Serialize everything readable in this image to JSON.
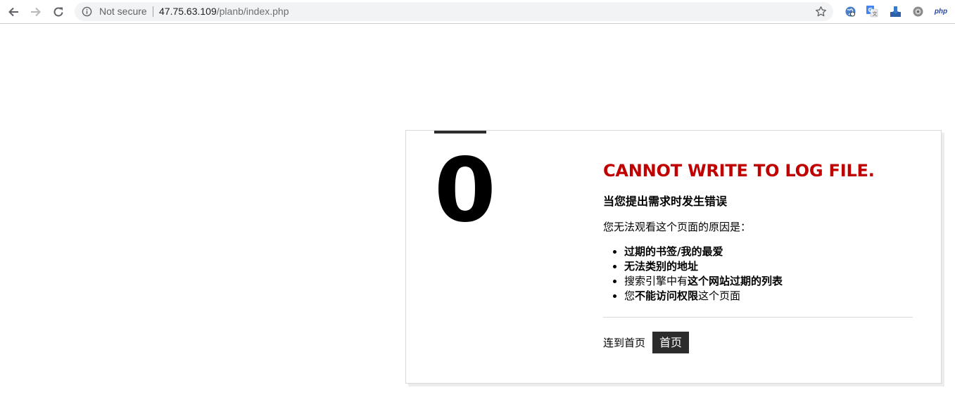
{
  "browser": {
    "back_icon": "arrow-left-icon",
    "forward_icon": "arrow-right-icon",
    "reload_icon": "reload-icon",
    "security_icon": "info-icon",
    "security_label": "Not secure",
    "url_host": "47.75.63.109",
    "url_path": "/planb/index.php",
    "bookmark_icon": "star-icon",
    "extensions": [
      {
        "name": "globe-extension-icon"
      },
      {
        "name": "translate-extension-icon"
      },
      {
        "name": "download-extension-icon"
      },
      {
        "name": "gear-extension-icon"
      },
      {
        "name": "php-extension-icon",
        "label": "php"
      }
    ]
  },
  "page": {
    "error_code": "0",
    "title": "CANNOT WRITE TO LOG FILE.",
    "subtitle": "当您提出需求时发生错误",
    "reason_intro": "您无法观看这个页面的原因是：",
    "reasons": [
      {
        "bold": "过期的书签/我的最爱",
        "plain": ""
      },
      {
        "bold": "无法类别的地址",
        "plain": ""
      },
      {
        "prefix": "搜索引擎中有",
        "bold": "这个网站过期的列表"
      },
      {
        "prefix": "您",
        "bold": "不能访问权限",
        "suffix": "这个页面"
      }
    ],
    "home_label": "连到首页",
    "home_button": "首页"
  },
  "colors": {
    "title_red": "#c00000",
    "button_dark": "#2c2c2c",
    "omnibox_bg": "#f1f3f4"
  }
}
